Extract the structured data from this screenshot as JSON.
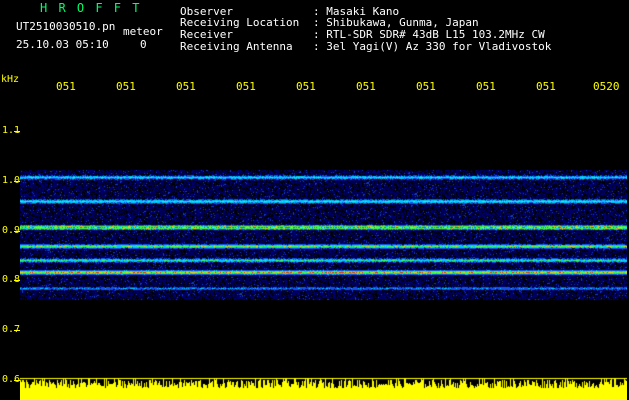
{
  "header": {
    "logo": "H R O F F T",
    "file_name": "UT2510030510.pn",
    "meteor_label": "meteor",
    "timestamp": "25.10.03 05:10",
    "count": "0",
    "observer_label": "Observer",
    "observer_value": ": Masaki Kano",
    "location_label": "Receiving Location",
    "location_value": ": Shibukawa, Gunma, Japan",
    "receiver_label": "Receiver",
    "receiver_value": ": RTL-SDR SDR# 43dB L15 103.2MHz CW",
    "antenna_label": "Receiving Antenna",
    "antenna_value": ": 3el Yagi(V) Az 330 for Vladivostok"
  },
  "axis": {
    "unit": "kHz",
    "x_ticks": [
      "051",
      "051",
      "051",
      "051",
      "051",
      "051",
      "051",
      "051",
      "051",
      "0520"
    ],
    "y_ticks": [
      "1.1",
      "1.0",
      "0.9",
      "0.8",
      "0.7",
      "0.6"
    ]
  },
  "colors": {
    "background": "#000000",
    "tick_color": "#ffff00",
    "noise_base": "#00007a",
    "signal_peak": "#ff2000",
    "logo_green": "#00ff6a"
  }
}
